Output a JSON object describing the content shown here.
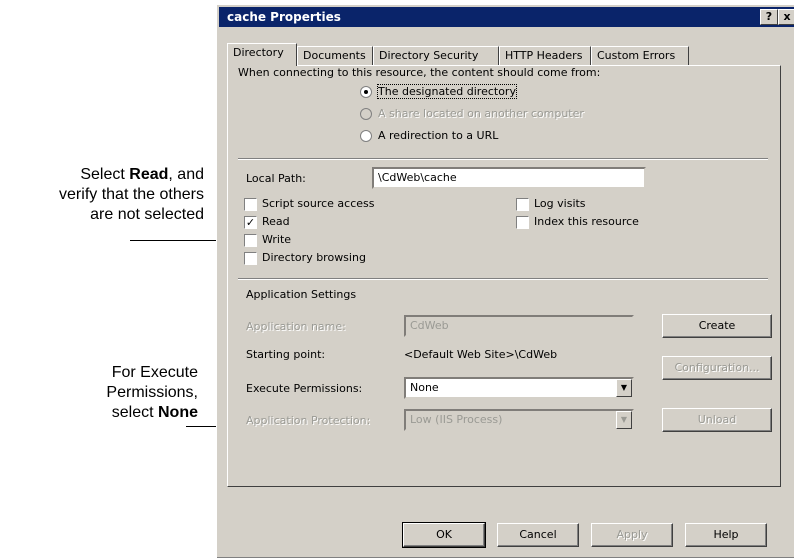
{
  "callouts": {
    "read": {
      "line1_prefix": "Select ",
      "line1_bold": "Read",
      "line1_suffix": ", and",
      "line2": "verify that the others",
      "line3": "are not selected"
    },
    "execute": {
      "line1": "For Execute",
      "line2": "Permissions,",
      "line3_prefix": "select ",
      "line3_bold": "None"
    }
  },
  "dialog": {
    "title": "cache Properties",
    "help_button": "?",
    "close_button": "x",
    "tabs": [
      "Directory",
      "Documents",
      "Directory Security",
      "HTTP Headers",
      "Custom Errors"
    ],
    "intro": "When connecting to this resource, the content should come from:",
    "source_options": [
      "The designated directory",
      "A share located on another computer",
      "A redirection to a URL"
    ],
    "selected_source": "The designated directory",
    "local_path_label": "Local Path:",
    "local_path_value": "\\CdWeb\\cache",
    "checks_left": [
      {
        "label": "Script source access",
        "checked": false
      },
      {
        "label": "Read",
        "checked": true
      },
      {
        "label": "Write",
        "checked": false
      },
      {
        "label": "Directory browsing",
        "checked": false
      }
    ],
    "checks_right": [
      {
        "label": "Log visits",
        "checked": false
      },
      {
        "label": "Index this resource",
        "checked": false
      }
    ],
    "app_settings_label": "Application Settings",
    "app_name_label": "Application name:",
    "app_name_value": "CdWeb",
    "create_button": "Create",
    "starting_point_label": "Starting point:",
    "starting_point_value": "<Default Web Site>\\CdWeb",
    "configuration_button": "Configuration...",
    "execute_label": "Execute Permissions:",
    "execute_value": "None",
    "protection_label": "Application Protection:",
    "protection_value": "Low (IIS Process)",
    "unload_button": "Unload",
    "ok_button": "OK",
    "cancel_button": "Cancel",
    "apply_button": "Apply",
    "help_bottom_button": "Help"
  }
}
